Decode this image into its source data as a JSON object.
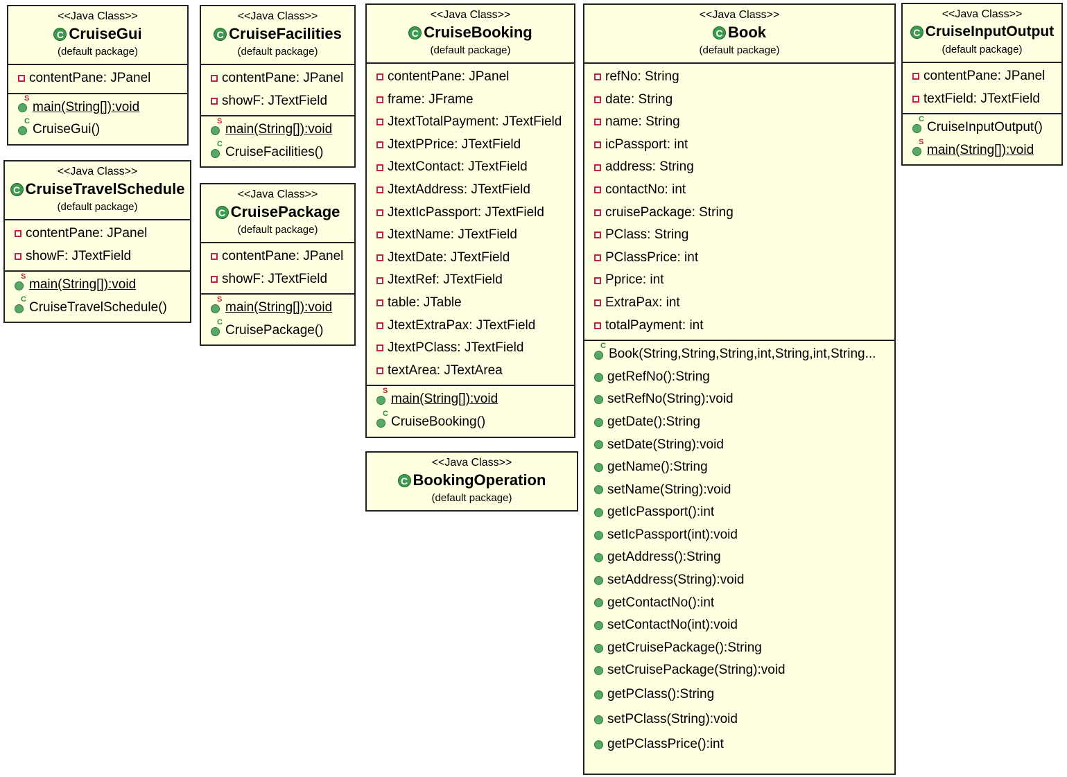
{
  "classes": {
    "gui": {
      "stereotype": "<<Java Class>>",
      "name": "CruiseGui",
      "package": "(default package)",
      "fields": [
        "contentPane: JPanel"
      ],
      "methods": [
        "main(String[]):void",
        "CruiseGui()"
      ]
    },
    "travel": {
      "stereotype": "<<Java Class>>",
      "name": "CruiseTravelSchedule",
      "package": "(default package)",
      "fields": [
        "contentPane: JPanel",
        "showF: JTextField"
      ],
      "methods": [
        "main(String[]):void",
        "CruiseTravelSchedule()"
      ]
    },
    "facilities": {
      "stereotype": "<<Java Class>>",
      "name": "CruiseFacilities",
      "package": "(default package)",
      "fields": [
        "contentPane: JPanel",
        "showF: JTextField"
      ],
      "methods": [
        "main(String[]):void",
        "CruiseFacilities()"
      ]
    },
    "package": {
      "stereotype": "<<Java Class>>",
      "name": "CruisePackage",
      "package": "(default package)",
      "fields": [
        "contentPane: JPanel",
        "showF: JTextField"
      ],
      "methods": [
        "main(String[]):void",
        "CruisePackage()"
      ]
    },
    "booking": {
      "stereotype": "<<Java Class>>",
      "name": "CruiseBooking",
      "package": "(default package)",
      "fields": [
        "contentPane: JPanel",
        "frame: JFrame",
        "JtextTotalPayment: JTextField",
        "JtextPPrice: JTextField",
        "JtextContact: JTextField",
        "JtextAddress: JTextField",
        "JtextIcPassport: JTextField",
        "JtextName: JTextField",
        "JtextDate: JTextField",
        "JtextRef: JTextField",
        "table: JTable",
        "JtextExtraPax: JTextField",
        "JtextPClass: JTextField",
        "textArea: JTextArea"
      ],
      "methods": [
        "main(String[]):void",
        "CruiseBooking()"
      ]
    },
    "bookingop": {
      "stereotype": "<<Java Class>>",
      "name": "BookingOperation",
      "package": "(default package)"
    },
    "book": {
      "stereotype": "<<Java Class>>",
      "name": "Book",
      "package": "(default package)",
      "fields": [
        "refNo: String",
        "date: String",
        "name: String",
        "icPassport: int",
        "address: String",
        "contactNo: int",
        "cruisePackage: String",
        "PClass: String",
        "PClassPrice: int",
        "Pprice: int",
        "ExtraPax: int",
        "totalPayment: int"
      ],
      "methods": [
        "Book(String,String,String,int,String,int,String...",
        "getRefNo():String",
        "setRefNo(String):void",
        "getDate():String",
        "setDate(String):void",
        "getName():String",
        "setName(String):void",
        "getIcPassport():int",
        "setIcPassport(int):void",
        "getAddress():String",
        "setAddress(String):void",
        "getContactNo():int",
        "setContactNo(int):void",
        "getCruisePackage():String",
        "setCruisePackage(String):void",
        "getPClass():String",
        "setPClass(String):void",
        "getPClassPrice():int"
      ]
    },
    "io": {
      "stereotype": "<<Java Class>>",
      "name": "CruiseInputOutput",
      "package": "(default package)",
      "fields": [
        "contentPane: JPanel",
        "textField: JTextField"
      ],
      "methods": [
        "CruiseInputOutput()",
        "main(String[]):void"
      ]
    }
  },
  "icons": {
    "class": "class-icon",
    "field": "private-field-icon",
    "method": "public-method-icon",
    "static_modifier": "S",
    "constructor_modifier": "C"
  },
  "colors": {
    "box_fill": "#ffffe1",
    "class_icon": "#3d9a4e",
    "field_icon": "#c0263b"
  }
}
